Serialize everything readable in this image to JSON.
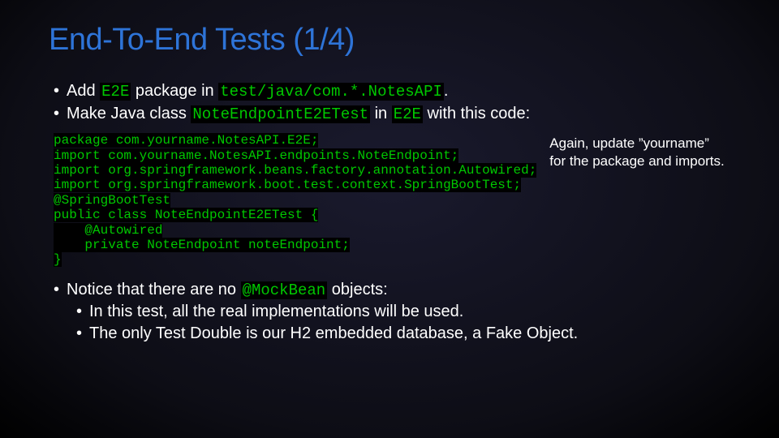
{
  "title": "End-To-End Tests (1/4)",
  "bullets_top": {
    "b1_pre": "Add ",
    "b1_code1": "E2E",
    "b1_mid": " package in ",
    "b1_code2": "test/java/com.*.NotesAPI",
    "b1_post": ".",
    "b2_pre": "Make Java class ",
    "b2_code1": "NoteEndpointE2ETest",
    "b2_mid": " in ",
    "b2_code2": "E2E",
    "b2_post": " with this code:"
  },
  "code": {
    "l1": "package com.yourname.NotesAPI.E2E;",
    "l2": "",
    "l3": "import com.yourname.NotesAPI.endpoints.NoteEndpoint;",
    "l4": "import org.springframework.beans.factory.annotation.Autowired;",
    "l5": "import org.springframework.boot.test.context.SpringBootTest;",
    "l6": "",
    "l7": "@SpringBootTest",
    "l8": "public class NoteEndpointE2ETest {",
    "l9": "    @Autowired",
    "l10": "    private NoteEndpoint noteEndpoint;",
    "l11": "}"
  },
  "side_note": "Again, update ”yourname” for the package and imports.",
  "bullets_bottom": {
    "b3_pre": "Notice that there are no ",
    "b3_code": "@MockBean",
    "b3_post": " objects:",
    "sub1": "In this test, all the real implementations will be used.",
    "sub2": "The only Test Double is our H2 embedded database, a Fake Object."
  }
}
